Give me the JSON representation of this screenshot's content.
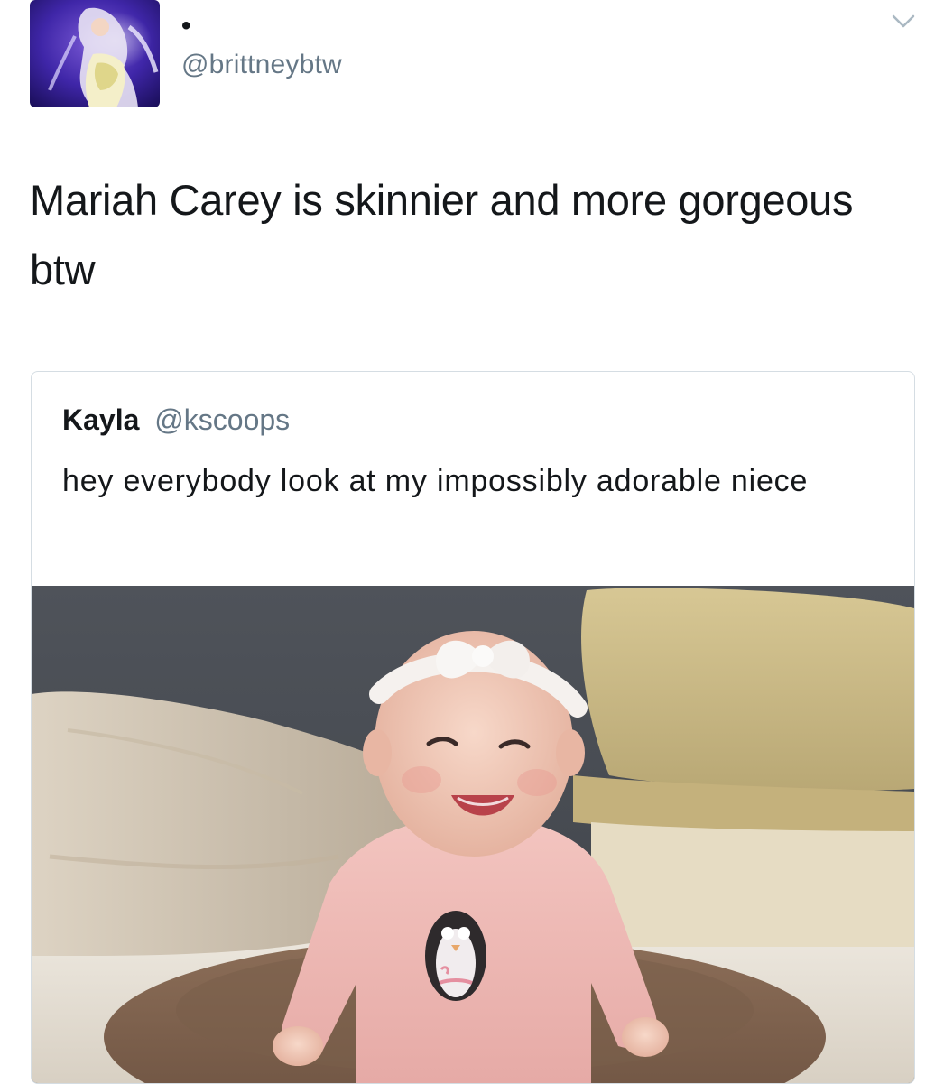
{
  "tweet": {
    "display_name": "•",
    "handle": "@brittneybtw",
    "text": "Mariah Carey is skinnier and more gorgeous btw",
    "menu_icon": "chevron-down-icon",
    "avatar_icon": "avatar"
  },
  "quoted_tweet": {
    "name": "Kayla",
    "handle": "@kscoops",
    "text": "hey everybody look at my impossibly adorable niece",
    "media_icon": "photo"
  },
  "colors": {
    "text_primary": "#14171a",
    "text_secondary": "#657786",
    "border": "#d5dde3",
    "background": "#ffffff"
  }
}
